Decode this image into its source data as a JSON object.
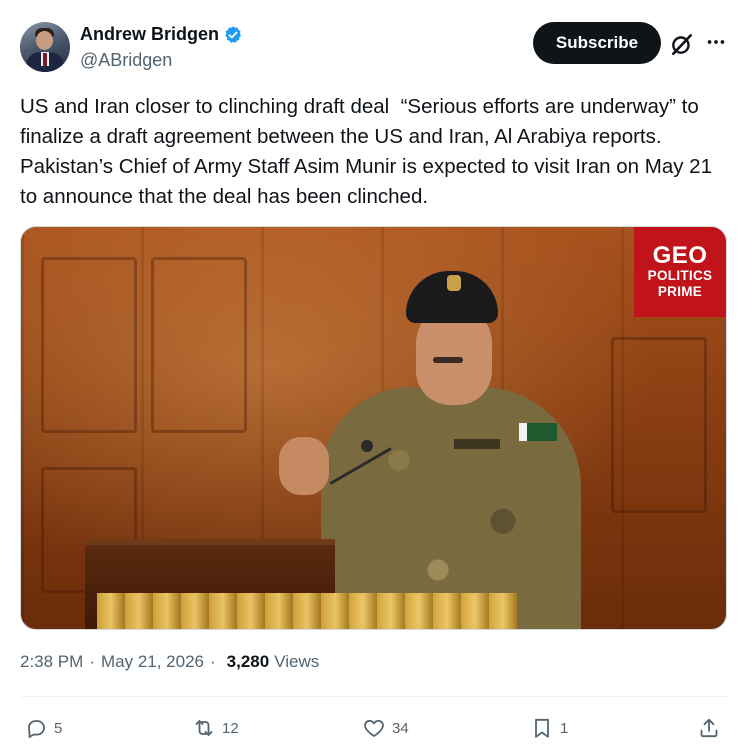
{
  "author": {
    "display_name": "Andrew Bridgen",
    "handle": "@ABridgen",
    "verified": true
  },
  "header": {
    "subscribe_label": "Subscribe",
    "grok_icon": "grok-icon",
    "more_icon": "more-icon"
  },
  "tweet": {
    "text": "US and Iran closer to clinching draft deal  “Serious efforts are underway” to finalize a draft agreement between the US and Iran, Al Arabiya reports.  Pakistan’s Chief of Army Staff Asim Munir is expected to visit Iran on May 21 to announce that the deal has been clinched."
  },
  "media": {
    "brand_line1": "GEO",
    "brand_line2": "POLITICS",
    "brand_line3": "PRIME",
    "brand_color": "#c0141a"
  },
  "meta": {
    "time": "2:38 PM",
    "separator": "·",
    "date": "May 21, 2026",
    "views_count": "3,280",
    "views_label": "Views"
  },
  "actions": {
    "replies": "5",
    "reposts": "12",
    "likes": "34",
    "bookmarks": "1"
  },
  "colors": {
    "text": "#0f1419",
    "secondary": "#536471",
    "verified": "#1d9bf0"
  }
}
